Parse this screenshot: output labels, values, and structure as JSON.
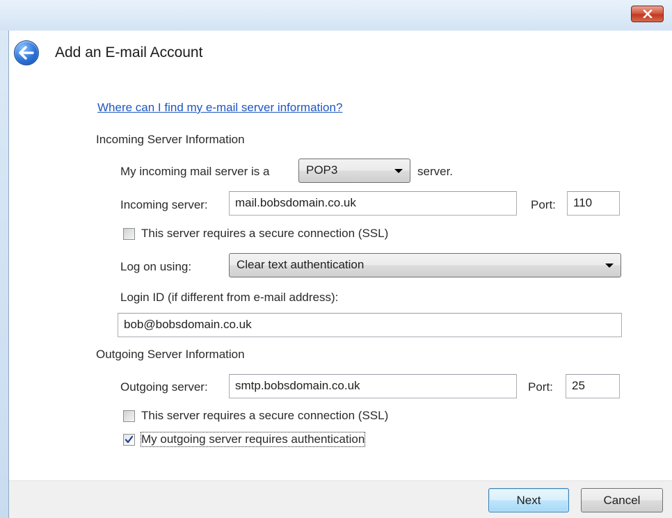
{
  "window": {
    "title": "Add an E-mail Account"
  },
  "help_link": "Where can I find my e-mail server information?",
  "incoming": {
    "group_label": "Incoming Server Information",
    "server_type_prefix": "My incoming mail server is a",
    "server_type_value": "POP3",
    "server_type_suffix": "server.",
    "server_label": "Incoming server:",
    "server_value": "mail.bobsdomain.co.uk",
    "port_label": "Port:",
    "port_value": "110",
    "ssl_label": "This server requires a secure connection (SSL)",
    "ssl_checked": false,
    "logon_label": "Log on using:",
    "logon_value": "Clear text authentication",
    "login_id_label": "Login ID (if different from e-mail address):",
    "login_id_value": "bob@bobsdomain.co.uk"
  },
  "outgoing": {
    "group_label": "Outgoing Server Information",
    "server_label": "Outgoing server:",
    "server_value": "smtp.bobsdomain.co.uk",
    "port_label": "Port:",
    "port_value": "25",
    "ssl_label": "This server requires a secure connection (SSL)",
    "ssl_checked": false,
    "auth_label": "My outgoing server requires authentication",
    "auth_checked": true
  },
  "buttons": {
    "next": "Next",
    "cancel": "Cancel"
  },
  "icons": {
    "close": "close-icon",
    "back": "back-arrow-icon",
    "dropdown": "chevron-down-icon",
    "check": "checkmark-icon"
  },
  "colors": {
    "link": "#1d56c2",
    "close_button": "#c0391f",
    "back_button": "#2a72d8"
  }
}
